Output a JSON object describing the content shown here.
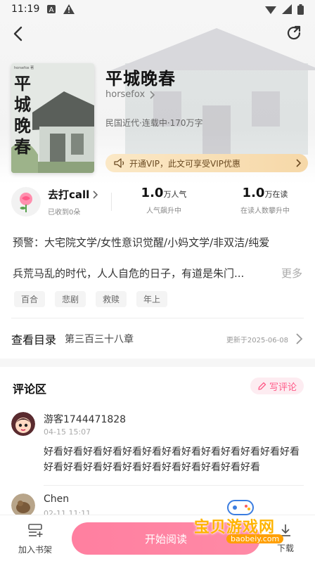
{
  "status_bar": {
    "time": "11:19"
  },
  "book": {
    "title": "平城晚春",
    "author": "horsefox",
    "meta": "民国近代·连载中·170万字",
    "cover_title": "平城晚春",
    "cover_author": "horsefox 著"
  },
  "vip": {
    "text": "开通VIP，此文可享受VIP优惠"
  },
  "fan": {
    "name": "去打call",
    "sub": "已收到0朵"
  },
  "stats": [
    {
      "num": "1.0",
      "unit": "万人气",
      "desc": "人气飙升中"
    },
    {
      "num": "1.0",
      "unit": "万在读",
      "desc": "在读人数攀升中"
    }
  ],
  "warning": "预警：大宅院文学/女性意识觉醒/小妈文学/非双洁/纯爱",
  "intro": {
    "text": "兵荒马乱的时代，人人自危的日子，有道是朱门...",
    "more": "更多"
  },
  "tags": [
    "百合",
    "悲剧",
    "救赎",
    "年上"
  ],
  "toc": {
    "label": "查看目录",
    "chapter": "第三百三十八章",
    "updated": "更新于2025-06-08"
  },
  "comments": {
    "title": "评论区",
    "write_label": "写评论",
    "items": [
      {
        "name": "游客1744471828",
        "time": "04-15 15:07",
        "body": "好看好看好看好看好看好看好看好看好看好看好看好看好看好看好看好看好看好看好看好看好看好看好看好看"
      },
      {
        "name": "Chen",
        "time": "02-11 11:11",
        "body": ""
      }
    ]
  },
  "bottom_bar": {
    "shelf_label": "加入书架",
    "read_label": "开始阅读",
    "download_label": "下载"
  },
  "watermark": {
    "text": "宝贝游戏网",
    "url": "baobeiy.com"
  },
  "colors": {
    "accent_pink": "#ff5a88",
    "read_button": "#ff8aa6",
    "vip_bg": "#f6d8a8"
  }
}
